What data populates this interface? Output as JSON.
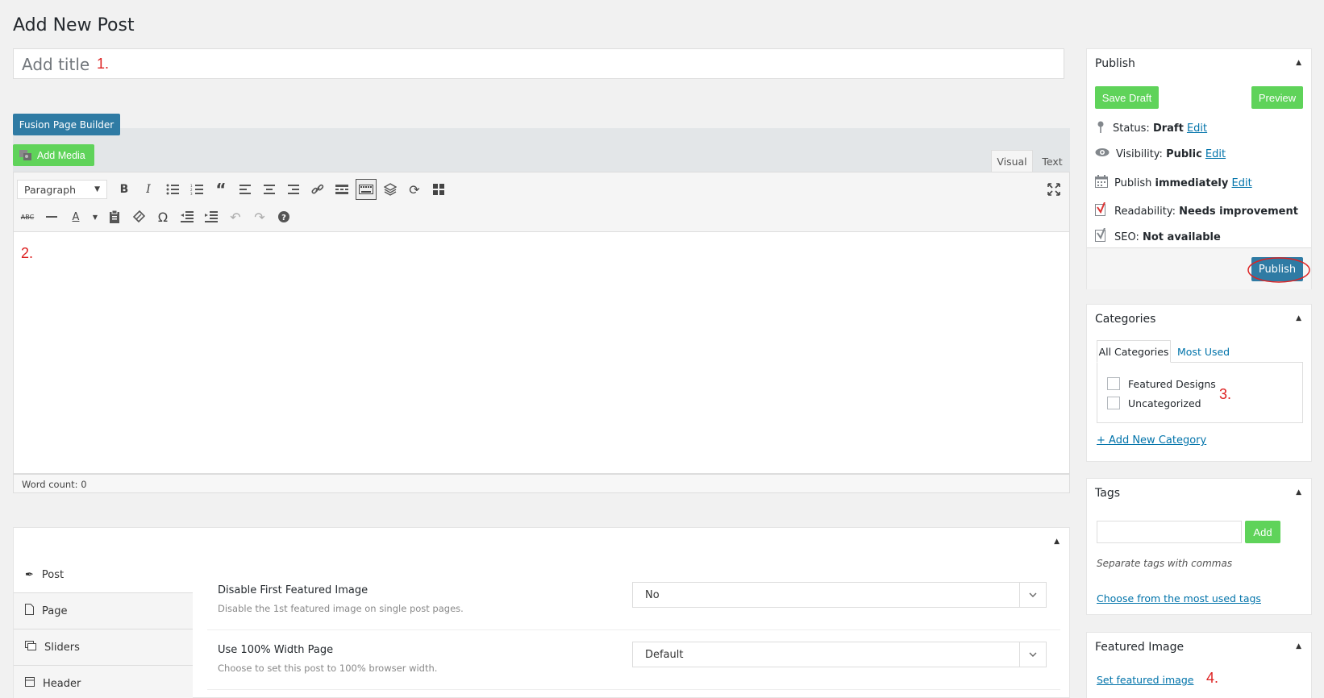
{
  "page": {
    "title": "Add New Post"
  },
  "title_field": {
    "placeholder": "Add title",
    "annotation": "1."
  },
  "editor": {
    "fusion_builder_label": "Fusion Page Builder",
    "add_media_label": "Add Media",
    "tabs": {
      "visual": "Visual",
      "text": "Text"
    },
    "format_select": "Paragraph",
    "annotation": "2.",
    "word_count": "Word count: 0"
  },
  "options_panel": {
    "nav": [
      {
        "label": "Post",
        "icon": "pin-icon"
      },
      {
        "label": "Page",
        "icon": "page-icon"
      },
      {
        "label": "Sliders",
        "icon": "sliders-icon"
      },
      {
        "label": "Header",
        "icon": "header-icon"
      }
    ],
    "fields": [
      {
        "label": "Disable First Featured Image",
        "description": "Disable the 1st featured image on single post pages.",
        "value": "No"
      },
      {
        "label": "Use 100% Width Page",
        "description": "Choose to set this post to 100% browser width.",
        "value": "Default"
      }
    ]
  },
  "publish_box": {
    "title": "Publish",
    "save_draft": "Save Draft",
    "preview": "Preview",
    "status_label": "Status:",
    "status_value": "Draft",
    "status_edit": "Edit",
    "visibility_label": "Visibility:",
    "visibility_value": "Public",
    "visibility_edit": "Edit",
    "publish_label": "Publish",
    "publish_value": "immediately",
    "publish_edit": "Edit",
    "readability_label": "Readability:",
    "readability_value": "Needs improvement",
    "seo_label": "SEO:",
    "seo_value": "Not available",
    "publish_button": "Publish"
  },
  "categories_box": {
    "title": "Categories",
    "tab_all": "All Categories",
    "tab_most_used": "Most Used",
    "items": [
      "Featured Designs",
      "Uncategorized"
    ],
    "annotation": "3.",
    "add_new": "+ Add New Category"
  },
  "tags_box": {
    "title": "Tags",
    "add_label": "Add",
    "hint": "Separate tags with commas",
    "choose_link": "Choose from the most used tags"
  },
  "featured_image_box": {
    "title": "Featured Image",
    "set_link": "Set featured image",
    "annotation": "4."
  },
  "colors": {
    "primary_blue": "#2f7ba4",
    "green": "#5fd35a",
    "annotation_red": "#dd2222",
    "link": "#0073aa"
  }
}
